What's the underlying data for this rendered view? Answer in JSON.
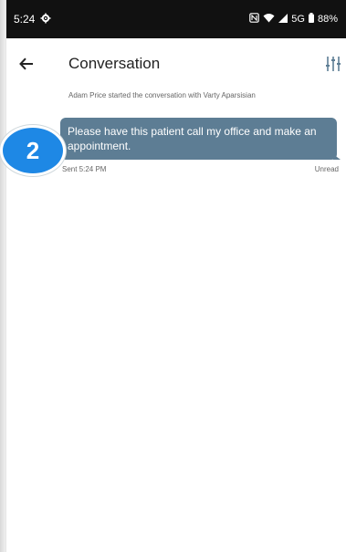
{
  "status_bar": {
    "time": "5:24",
    "network": "5G",
    "battery": "88%"
  },
  "app_bar": {
    "title": "Conversation"
  },
  "conversation": {
    "started_text": "Adam Price started the conversation with Varty Aparsisian",
    "message": "Please have this patient call my office and make an appointment.",
    "sent_label": "Sent 5:24 PM",
    "status_label": "Unread"
  },
  "callout": {
    "number": "2"
  },
  "colors": {
    "bubble": "#5d7d94",
    "callout": "#1e88e5",
    "status_bar": "#111111"
  }
}
